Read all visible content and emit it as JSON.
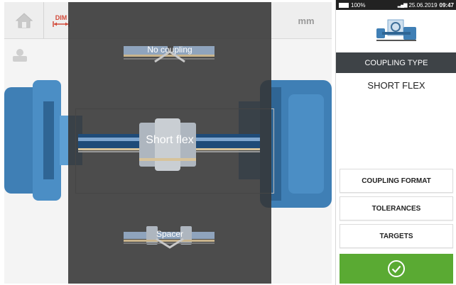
{
  "toolbar": {
    "dimension_tab": "DIM",
    "unit": "mm",
    "icons": {
      "home": "home-icon",
      "dimensions": "dimension-arrows-icon",
      "machine": "machine-icon"
    }
  },
  "coupling_selector": {
    "options": [
      {
        "label": "No coupling",
        "selected": false
      },
      {
        "label": "Short flex",
        "selected": true
      },
      {
        "label": "Spacer",
        "selected": false
      }
    ],
    "icons": {
      "up": "chevron-up-icon",
      "down": "chevron-down-icon"
    }
  },
  "status_bar": {
    "battery": "100%",
    "date": "25.06.2019",
    "time": "09:47"
  },
  "panel": {
    "header": "COUPLING TYPE",
    "selected_value": "SHORT FLEX",
    "buttons": {
      "format": "COUPLING FORMAT",
      "tolerances": "TOLERANCES",
      "targets": "TARGETS"
    },
    "confirm_icon": "check-circle-icon"
  },
  "colors": {
    "accent_green": "#5aaa33",
    "header_dark": "#3e4347",
    "dim_red": "#d24a3a",
    "machine_blue": "#3f7fb5"
  }
}
